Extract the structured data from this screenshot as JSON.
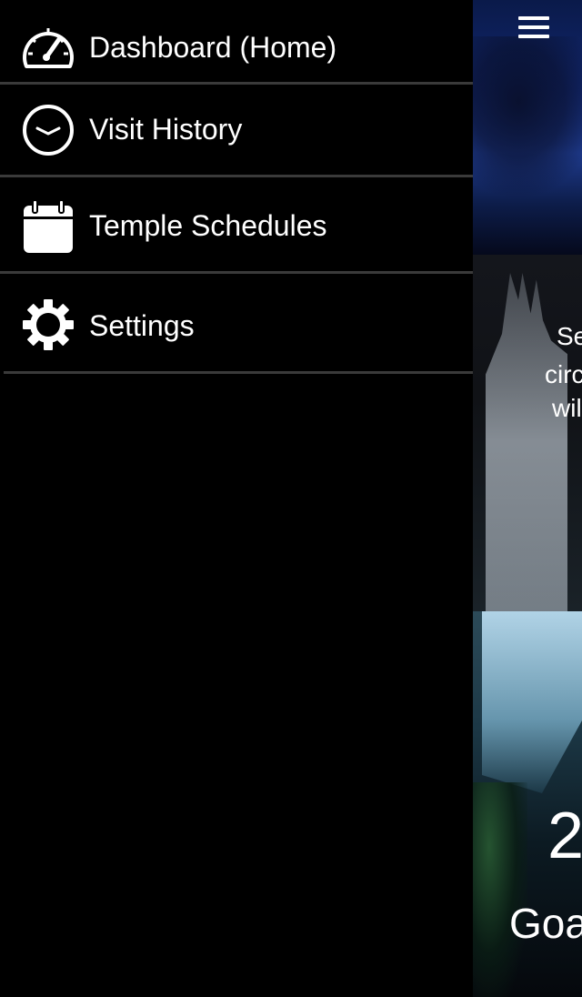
{
  "drawer": {
    "items": [
      {
        "label": "Dashboard (Home)",
        "icon": "speedometer-icon"
      },
      {
        "label": "Visit History",
        "icon": "clock-icon"
      },
      {
        "label": "Temple Schedules",
        "icon": "calendar-icon"
      },
      {
        "label": "Settings",
        "icon": "gear-icon"
      }
    ]
  },
  "main": {
    "menu_icon": "hamburger-menu-icon",
    "partial_text": [
      "Se",
      "circ",
      "wil"
    ],
    "partial_number": "2",
    "partial_goal_label": "Goa"
  },
  "colors": {
    "drawer_bg": "#000000",
    "divider": "#3a3a3a",
    "text": "#ffffff"
  }
}
